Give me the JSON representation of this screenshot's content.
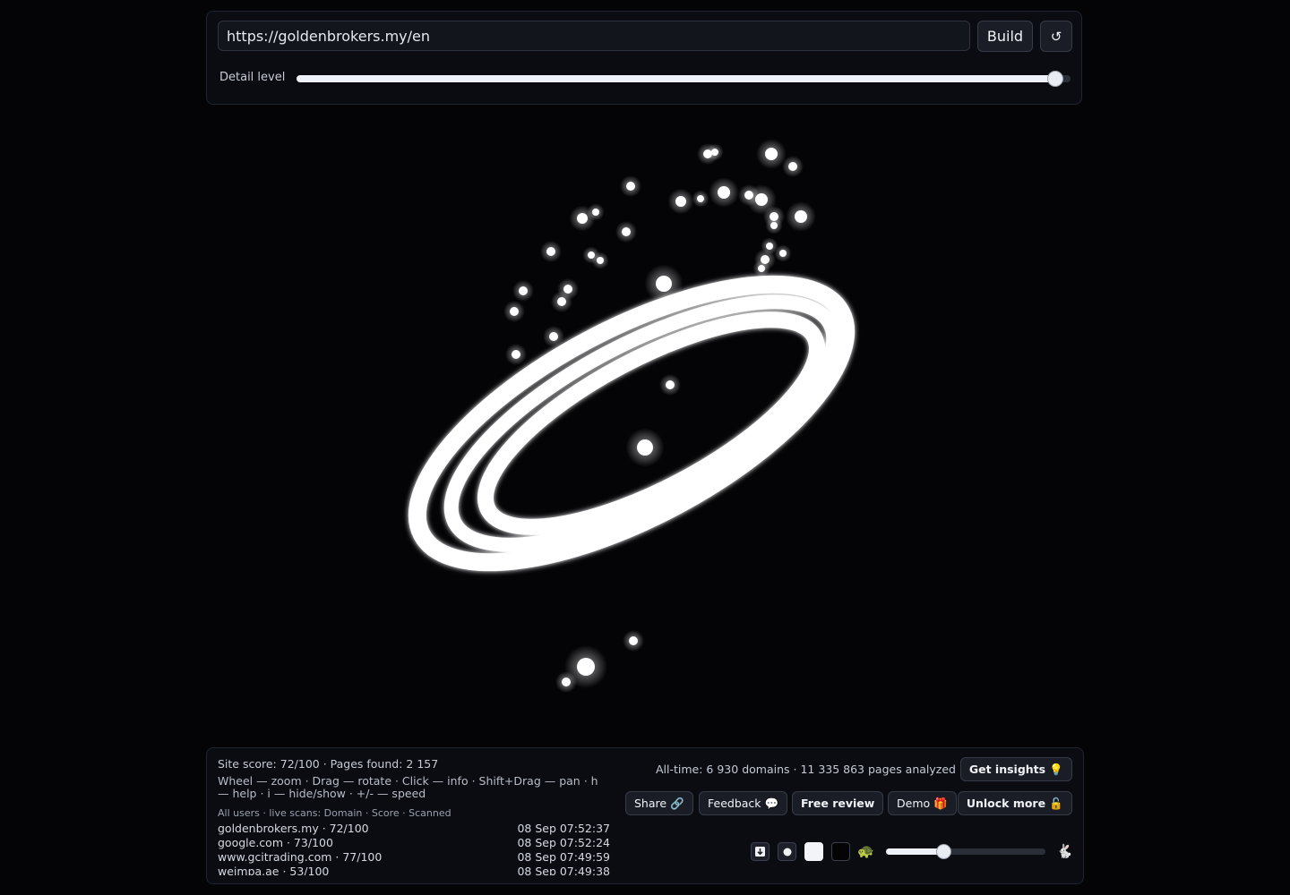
{
  "top": {
    "url_value": "https://goldenbrokers.my/en",
    "build_label": "Build",
    "reload_icon": "↺",
    "detail_label": "Detail level",
    "detail_level": 0.98
  },
  "footer": {
    "site_score": "Site score: 72/100 · Pages found: 2 157",
    "help": "Wheel — zoom · Drag — rotate · Click — info · Shift+Drag — pan · h — help · i — hide/show · +/- — speed",
    "scans_title": "All users · live scans: Domain · Score · Scanned",
    "scans": [
      {
        "domain": "goldenbrokers.my · 72/100",
        "time": "08 Sep 07:52:37"
      },
      {
        "domain": "google.com · 73/100",
        "time": "08 Sep 07:52:24"
      },
      {
        "domain": "www.gcitrading.com · 77/100",
        "time": "08 Sep 07:49:59"
      },
      {
        "domain": "weimpa.ae · 53/100",
        "time": "08 Sep 07:49:38"
      }
    ],
    "alltime": "All-time: 6 930 domains · 11 335 863 pages analyzed",
    "insights_label": "Get insights 💡",
    "share_label": "Share 🔗",
    "feedback_label": "Feedback 💬",
    "review_label": "Free review",
    "demo_label": "Demo 🎁",
    "unlock_label": "Unlock more 🔓",
    "turtle_icon": "🐢",
    "rabbit_icon": "🐇",
    "speed_level": 0.36
  },
  "colors": {
    "background": "#040407",
    "panel": "#0a0c11",
    "nodes": "#ffffff"
  },
  "icons": [
    "refresh-icon",
    "download-icon",
    "dot-icon",
    "white-theme-swatch",
    "black-theme-swatch",
    "turtle-icon",
    "rabbit-icon"
  ]
}
